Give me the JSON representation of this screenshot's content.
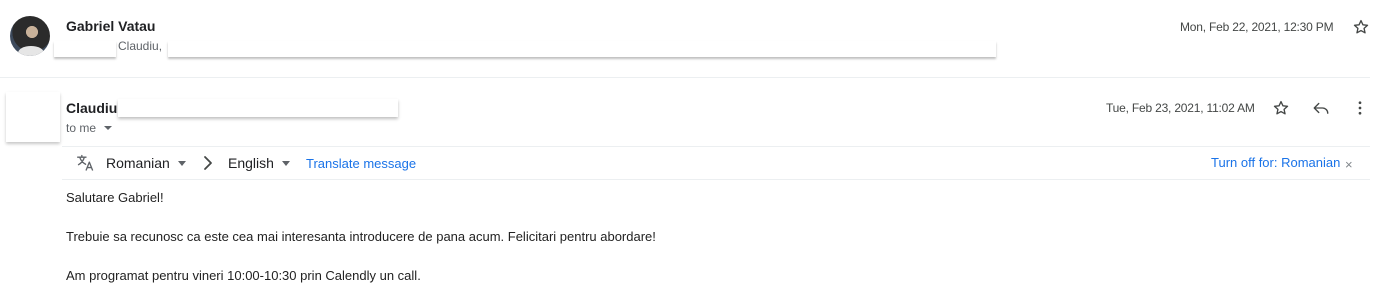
{
  "message1": {
    "sender": "Gabriel Vatau",
    "snippet_prefix": "Claudiu,",
    "date": "Mon, Feb 22, 2021, 12:30 PM"
  },
  "message2": {
    "sender": "Claudiu",
    "to_label": "to me",
    "date": "Tue, Feb 23, 2021, 11:02 AM"
  },
  "translate_bar": {
    "from_language": "Romanian",
    "to_language": "English",
    "translate_link": "Translate message",
    "turn_off_link": "Turn off for: Romanian",
    "close_glyph": "×"
  },
  "body": {
    "line1": "Salutare Gabriel!",
    "line2": "Trebuie sa recunosc ca este cea mai interesanta introducere de pana acum. Felicitari pentru abordare!",
    "line3": "Am programat pentru vineri 10:00-10:30 prin Calendly un call."
  },
  "icons": {
    "star": "star-icon",
    "reply": "reply-icon",
    "more": "more-vert-icon",
    "translate": "translate-icon",
    "arrow": "chevron-right-icon"
  }
}
